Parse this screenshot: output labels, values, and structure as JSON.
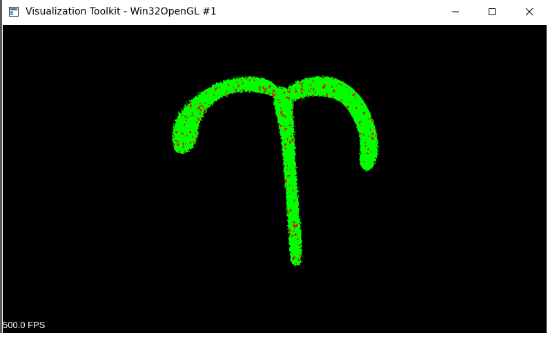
{
  "window": {
    "title": "Visualization Toolkit - Win32OpenGL #1",
    "controls": {
      "minimize_icon": "minimize-icon",
      "maximize_icon": "maximize-icon",
      "close_icon": "close-icon"
    }
  },
  "render": {
    "background_color": "#000000",
    "surface_color": "#00ff00",
    "noise_color": "#cc2200",
    "fps_label": "500.0 FPS"
  }
}
